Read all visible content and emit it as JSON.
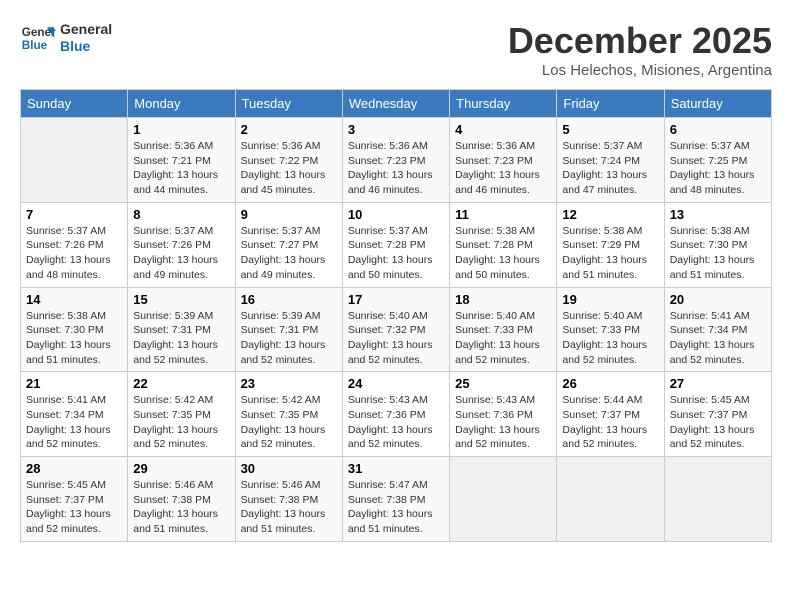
{
  "header": {
    "logo_line1": "General",
    "logo_line2": "Blue",
    "month_year": "December 2025",
    "location": "Los Helechos, Misiones, Argentina"
  },
  "days_of_week": [
    "Sunday",
    "Monday",
    "Tuesday",
    "Wednesday",
    "Thursday",
    "Friday",
    "Saturday"
  ],
  "weeks": [
    [
      {
        "day": "",
        "sunrise": "",
        "sunset": "",
        "daylight": ""
      },
      {
        "day": "1",
        "sunrise": "Sunrise: 5:36 AM",
        "sunset": "Sunset: 7:21 PM",
        "daylight": "Daylight: 13 hours and 44 minutes."
      },
      {
        "day": "2",
        "sunrise": "Sunrise: 5:36 AM",
        "sunset": "Sunset: 7:22 PM",
        "daylight": "Daylight: 13 hours and 45 minutes."
      },
      {
        "day": "3",
        "sunrise": "Sunrise: 5:36 AM",
        "sunset": "Sunset: 7:23 PM",
        "daylight": "Daylight: 13 hours and 46 minutes."
      },
      {
        "day": "4",
        "sunrise": "Sunrise: 5:36 AM",
        "sunset": "Sunset: 7:23 PM",
        "daylight": "Daylight: 13 hours and 46 minutes."
      },
      {
        "day": "5",
        "sunrise": "Sunrise: 5:37 AM",
        "sunset": "Sunset: 7:24 PM",
        "daylight": "Daylight: 13 hours and 47 minutes."
      },
      {
        "day": "6",
        "sunrise": "Sunrise: 5:37 AM",
        "sunset": "Sunset: 7:25 PM",
        "daylight": "Daylight: 13 hours and 48 minutes."
      }
    ],
    [
      {
        "day": "7",
        "sunrise": "Sunrise: 5:37 AM",
        "sunset": "Sunset: 7:26 PM",
        "daylight": "Daylight: 13 hours and 48 minutes."
      },
      {
        "day": "8",
        "sunrise": "Sunrise: 5:37 AM",
        "sunset": "Sunset: 7:26 PM",
        "daylight": "Daylight: 13 hours and 49 minutes."
      },
      {
        "day": "9",
        "sunrise": "Sunrise: 5:37 AM",
        "sunset": "Sunset: 7:27 PM",
        "daylight": "Daylight: 13 hours and 49 minutes."
      },
      {
        "day": "10",
        "sunrise": "Sunrise: 5:37 AM",
        "sunset": "Sunset: 7:28 PM",
        "daylight": "Daylight: 13 hours and 50 minutes."
      },
      {
        "day": "11",
        "sunrise": "Sunrise: 5:38 AM",
        "sunset": "Sunset: 7:28 PM",
        "daylight": "Daylight: 13 hours and 50 minutes."
      },
      {
        "day": "12",
        "sunrise": "Sunrise: 5:38 AM",
        "sunset": "Sunset: 7:29 PM",
        "daylight": "Daylight: 13 hours and 51 minutes."
      },
      {
        "day": "13",
        "sunrise": "Sunrise: 5:38 AM",
        "sunset": "Sunset: 7:30 PM",
        "daylight": "Daylight: 13 hours and 51 minutes."
      }
    ],
    [
      {
        "day": "14",
        "sunrise": "Sunrise: 5:38 AM",
        "sunset": "Sunset: 7:30 PM",
        "daylight": "Daylight: 13 hours and 51 minutes."
      },
      {
        "day": "15",
        "sunrise": "Sunrise: 5:39 AM",
        "sunset": "Sunset: 7:31 PM",
        "daylight": "Daylight: 13 hours and 52 minutes."
      },
      {
        "day": "16",
        "sunrise": "Sunrise: 5:39 AM",
        "sunset": "Sunset: 7:31 PM",
        "daylight": "Daylight: 13 hours and 52 minutes."
      },
      {
        "day": "17",
        "sunrise": "Sunrise: 5:40 AM",
        "sunset": "Sunset: 7:32 PM",
        "daylight": "Daylight: 13 hours and 52 minutes."
      },
      {
        "day": "18",
        "sunrise": "Sunrise: 5:40 AM",
        "sunset": "Sunset: 7:33 PM",
        "daylight": "Daylight: 13 hours and 52 minutes."
      },
      {
        "day": "19",
        "sunrise": "Sunrise: 5:40 AM",
        "sunset": "Sunset: 7:33 PM",
        "daylight": "Daylight: 13 hours and 52 minutes."
      },
      {
        "day": "20",
        "sunrise": "Sunrise: 5:41 AM",
        "sunset": "Sunset: 7:34 PM",
        "daylight": "Daylight: 13 hours and 52 minutes."
      }
    ],
    [
      {
        "day": "21",
        "sunrise": "Sunrise: 5:41 AM",
        "sunset": "Sunset: 7:34 PM",
        "daylight": "Daylight: 13 hours and 52 minutes."
      },
      {
        "day": "22",
        "sunrise": "Sunrise: 5:42 AM",
        "sunset": "Sunset: 7:35 PM",
        "daylight": "Daylight: 13 hours and 52 minutes."
      },
      {
        "day": "23",
        "sunrise": "Sunrise: 5:42 AM",
        "sunset": "Sunset: 7:35 PM",
        "daylight": "Daylight: 13 hours and 52 minutes."
      },
      {
        "day": "24",
        "sunrise": "Sunrise: 5:43 AM",
        "sunset": "Sunset: 7:36 PM",
        "daylight": "Daylight: 13 hours and 52 minutes."
      },
      {
        "day": "25",
        "sunrise": "Sunrise: 5:43 AM",
        "sunset": "Sunset: 7:36 PM",
        "daylight": "Daylight: 13 hours and 52 minutes."
      },
      {
        "day": "26",
        "sunrise": "Sunrise: 5:44 AM",
        "sunset": "Sunset: 7:37 PM",
        "daylight": "Daylight: 13 hours and 52 minutes."
      },
      {
        "day": "27",
        "sunrise": "Sunrise: 5:45 AM",
        "sunset": "Sunset: 7:37 PM",
        "daylight": "Daylight: 13 hours and 52 minutes."
      }
    ],
    [
      {
        "day": "28",
        "sunrise": "Sunrise: 5:45 AM",
        "sunset": "Sunset: 7:37 PM",
        "daylight": "Daylight: 13 hours and 52 minutes."
      },
      {
        "day": "29",
        "sunrise": "Sunrise: 5:46 AM",
        "sunset": "Sunset: 7:38 PM",
        "daylight": "Daylight: 13 hours and 51 minutes."
      },
      {
        "day": "30",
        "sunrise": "Sunrise: 5:46 AM",
        "sunset": "Sunset: 7:38 PM",
        "daylight": "Daylight: 13 hours and 51 minutes."
      },
      {
        "day": "31",
        "sunrise": "Sunrise: 5:47 AM",
        "sunset": "Sunset: 7:38 PM",
        "daylight": "Daylight: 13 hours and 51 minutes."
      },
      {
        "day": "",
        "sunrise": "",
        "sunset": "",
        "daylight": ""
      },
      {
        "day": "",
        "sunrise": "",
        "sunset": "",
        "daylight": ""
      },
      {
        "day": "",
        "sunrise": "",
        "sunset": "",
        "daylight": ""
      }
    ]
  ]
}
